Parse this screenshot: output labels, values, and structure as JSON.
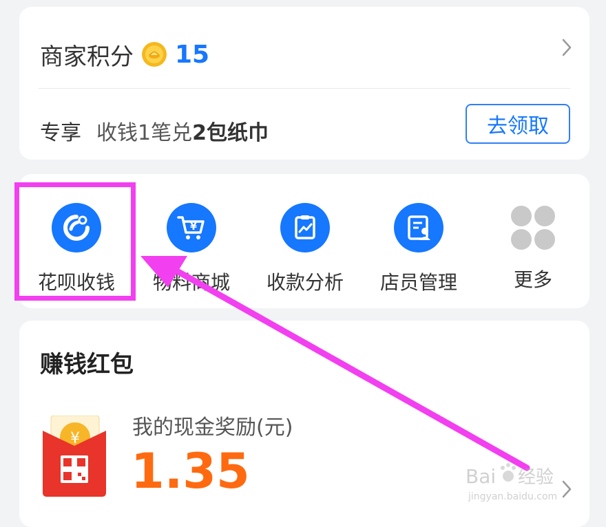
{
  "points": {
    "label": "商家积分",
    "value": "15",
    "coin_icon": "gold-coin-icon",
    "arrow_icon": "chevron-right-icon"
  },
  "promo": {
    "tag": "专享",
    "text_prefix": "收钱1笔兑",
    "text_bold": "2包纸巾",
    "button_label": "去领取"
  },
  "actions": [
    {
      "label": "花呗收钱",
      "icon": "huabei-icon"
    },
    {
      "label": "物料商城",
      "icon": "cart-yen-icon"
    },
    {
      "label": "收款分析",
      "icon": "chart-clipboard-icon"
    },
    {
      "label": "店员管理",
      "icon": "staff-card-icon"
    },
    {
      "label": "更多",
      "icon": "more-grid-icon"
    }
  ],
  "red_packet": {
    "title": "赚钱红包",
    "caption": "我的现金奖励(元)",
    "amount": "1.35",
    "icon": "red-packet-qr-icon"
  },
  "watermark": {
    "brand": "Bai",
    "brand_tail": "经验",
    "url": "jingyan.baidu.com"
  },
  "colors": {
    "accent_blue": "#1677ff",
    "amount_orange": "#ff6a10",
    "annotation_magenta": "#f23ff0",
    "background": "#f2f3f5"
  }
}
